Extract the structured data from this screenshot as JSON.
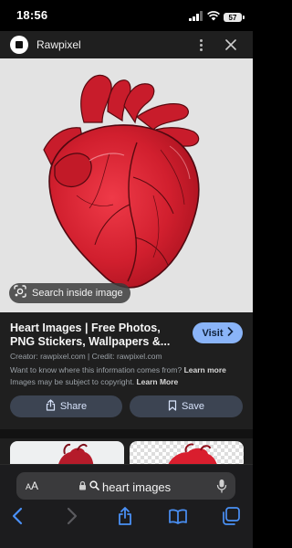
{
  "status_bar": {
    "time": "18:56",
    "battery": "57"
  },
  "header": {
    "site_name": "Rawpixel"
  },
  "image_overlay": {
    "search_label": "Search inside image"
  },
  "result": {
    "title": "Heart Images | Free Photos, PNG Stickers, Wallpapers &...",
    "visit_label": "Visit",
    "credit": "Creator: rawpixel.com | Credit: rawpixel.com",
    "disclaimer_text": "Want to know where this information comes from?",
    "learn_more_1": "Learn more",
    "copyright_text": "Images may be subject to copyright.",
    "learn_more_2": "Learn More",
    "share_label": "Share",
    "save_label": "Save"
  },
  "browser": {
    "aa_large": "A",
    "aa_small": "A",
    "url": "heart images"
  },
  "colors": {
    "accent": "#8ab4f8",
    "panel": "#1f1f1f",
    "heart": "#d11f2e"
  },
  "icons": [
    "signal-icon",
    "wifi-icon",
    "kebab-menu-icon",
    "close-icon",
    "lens-icon",
    "chevron-right-icon",
    "share-icon",
    "bookmark-icon",
    "lock-icon",
    "search-icon",
    "mic-icon",
    "back-icon",
    "forward-icon",
    "share-sheet-icon",
    "book-icon",
    "tabs-icon"
  ]
}
